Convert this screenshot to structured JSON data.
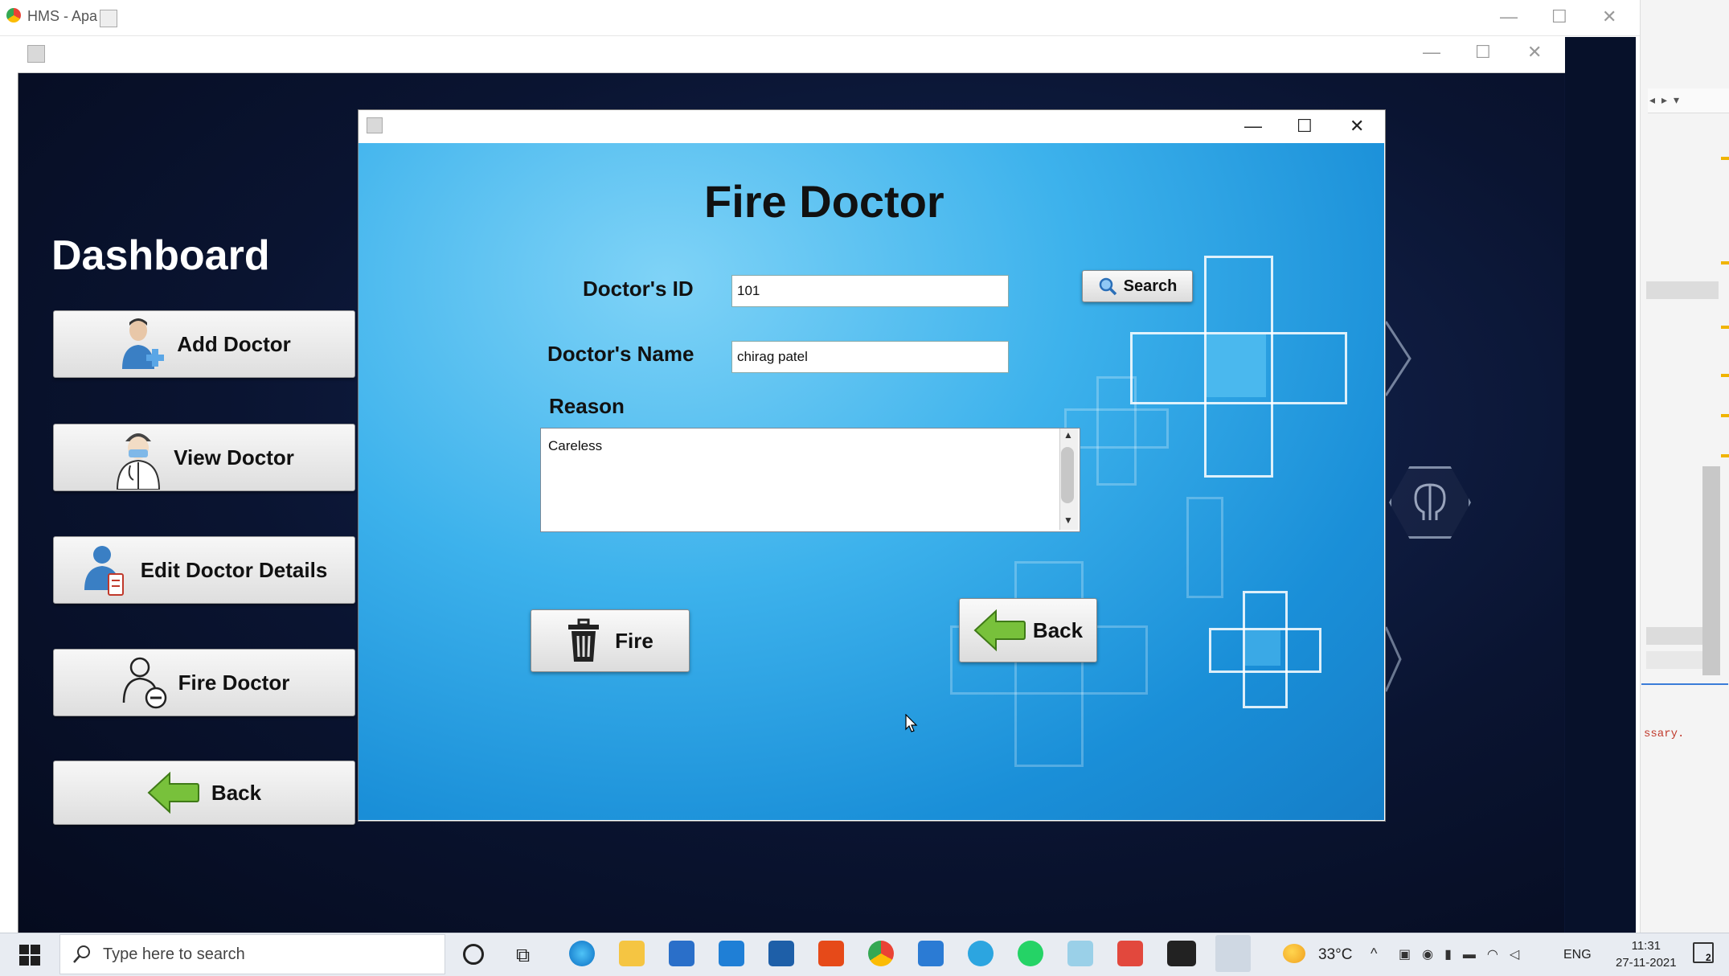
{
  "background_window": {
    "title": "HMS - Apa"
  },
  "ide": {
    "code_fragment": "ssary."
  },
  "dashboard": {
    "title": "Dashboard",
    "buttons": [
      {
        "label": "Add Doctor",
        "icon": "add-doctor-icon"
      },
      {
        "label": "View Doctor",
        "icon": "doctor-icon"
      },
      {
        "label": "Edit Doctor Details",
        "icon": "edit-doctor-icon"
      },
      {
        "label": "Fire Doctor",
        "icon": "remove-doctor-icon"
      },
      {
        "label": "Back",
        "icon": "back-arrow-icon"
      }
    ]
  },
  "dialog": {
    "title": "Fire Doctor",
    "doctor_id_label": "Doctor's ID",
    "doctor_id_value": "101",
    "doctor_name_label": "Doctor's Name",
    "doctor_name_value": "chirag patel",
    "reason_label": "Reason",
    "reason_value": "Careless",
    "search_label": "Search",
    "fire_label": "Fire",
    "back_label": "Back"
  },
  "taskbar": {
    "search_placeholder": "Type here to search",
    "temperature": "33°C",
    "language": "ENG",
    "time": "11:31",
    "date": "27-11-2021",
    "notification_count": "2"
  },
  "colors": {
    "dashboard_bg": "#0b1633",
    "dialog_bg": "#3db2ec",
    "button_face": "#e6e6e6",
    "arrow_green": "#6ab42d"
  }
}
